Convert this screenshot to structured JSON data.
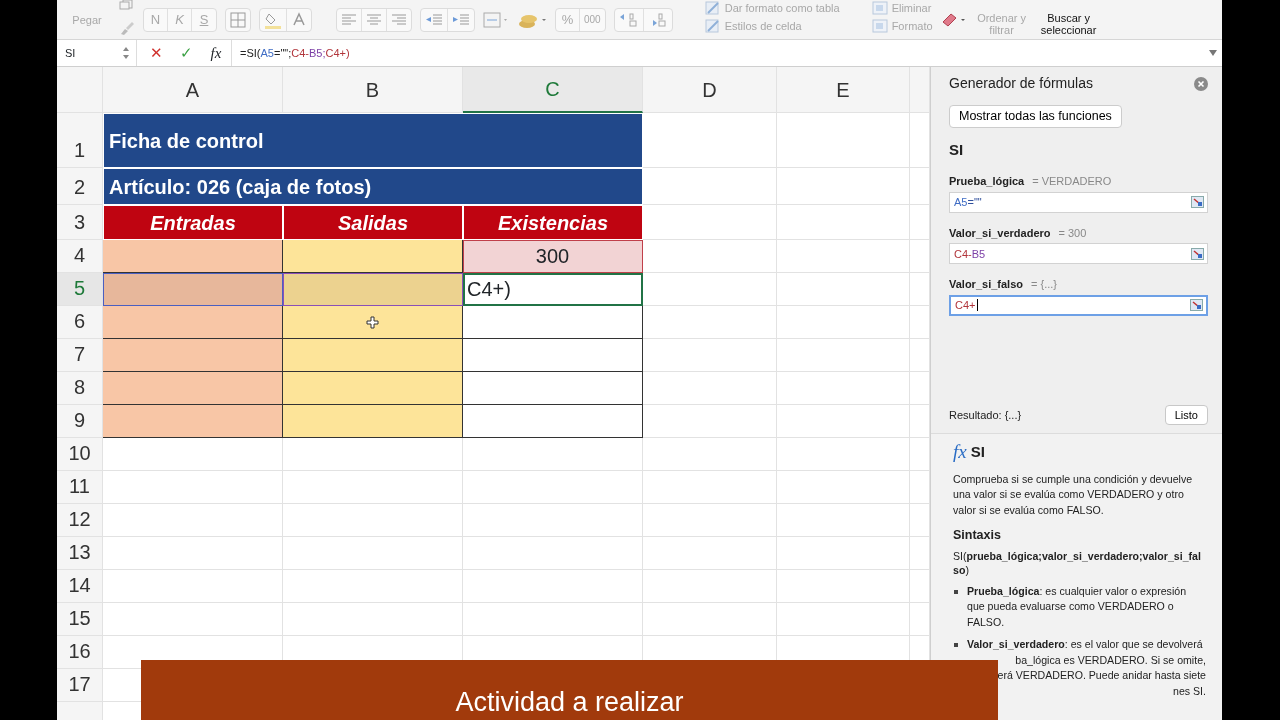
{
  "ribbon": {
    "paste": {
      "label": "Pegar",
      "disabled": true
    },
    "font_buttons": [
      {
        "label": "N",
        "disabled": true
      },
      {
        "label": "K",
        "disabled": true
      },
      {
        "label": "S",
        "disabled": true
      }
    ],
    "number_buttons": [
      {
        "label": "%",
        "disabled": true
      },
      {
        "label": "000",
        "disabled": true
      }
    ],
    "style_commands": [
      {
        "label": "Dar formato como tabla",
        "disabled": true
      },
      {
        "label": "Estilos de celda",
        "disabled": true
      }
    ],
    "cell_commands": [
      {
        "label": "Eliminar",
        "disabled": true
      },
      {
        "label": "Formato",
        "disabled": true
      }
    ],
    "sort_button": {
      "label": "Ordenar y filtrar",
      "disabled": true
    },
    "find_button": {
      "label": "Buscar y seleccionar",
      "disabled": false
    }
  },
  "formula_bar": {
    "name_box": "SI",
    "cancel": "✕",
    "enter": "✓",
    "fx": "fx",
    "tokens": [
      {
        "text": "=SI(",
        "color": "#222222"
      },
      {
        "text": "A5",
        "color": "#3f6cc4"
      },
      {
        "text": "=\"\";",
        "color": "#222222"
      },
      {
        "text": "C4-",
        "color": "#b1343a"
      },
      {
        "text": "B5;",
        "color": "#7c3fa6"
      },
      {
        "text": "C4+)",
        "color": "#b1343a"
      }
    ]
  },
  "sheet": {
    "columns": [
      {
        "label": "A",
        "selected": false
      },
      {
        "label": "B",
        "selected": false
      },
      {
        "label": "C",
        "selected": true
      },
      {
        "label": "D",
        "selected": false
      },
      {
        "label": "E",
        "selected": false
      }
    ],
    "rows": [
      {
        "label": "1",
        "selected": false,
        "cells": [
          {
            "kind": "title",
            "text": "Ficha de control"
          }
        ]
      },
      {
        "label": "2",
        "selected": false,
        "cells": [
          {
            "kind": "title",
            "text": "Artículo: 026 (caja de fotos)"
          }
        ]
      },
      {
        "label": "3",
        "selected": false,
        "cells": [
          {
            "kind": "header",
            "text": "Entradas"
          },
          {
            "kind": "header",
            "text": "Salidas"
          },
          {
            "kind": "header",
            "text": "Existencias"
          }
        ]
      },
      {
        "label": "4",
        "selected": false,
        "cells": [
          {
            "kind": "entrada"
          },
          {
            "kind": "salida"
          },
          {
            "kind": "existencia",
            "text": "300",
            "color": "#c0404a"
          }
        ]
      },
      {
        "label": "5",
        "selected": true,
        "cells": [
          {
            "kind": "entrada",
            "color": "#4a5fc1"
          },
          {
            "kind": "salida",
            "color": "#8a4fb8"
          },
          {
            "kind": "plain",
            "text": "C4+)",
            "editing": true
          }
        ]
      },
      {
        "label": "6",
        "selected": false,
        "cells": [
          {
            "kind": "entrada"
          },
          {
            "kind": "salida"
          },
          {
            "kind": "plain"
          }
        ]
      },
      {
        "label": "7",
        "selected": false,
        "cells": [
          {
            "kind": "entrada"
          },
          {
            "kind": "salida"
          },
          {
            "kind": "plain"
          }
        ]
      },
      {
        "label": "8",
        "selected": false,
        "cells": [
          {
            "kind": "entrada"
          },
          {
            "kind": "salida"
          },
          {
            "kind": "plain"
          }
        ]
      },
      {
        "label": "9",
        "selected": false,
        "cells": [
          {
            "kind": "entrada"
          },
          {
            "kind": "salida"
          },
          {
            "kind": "plain"
          }
        ]
      },
      {
        "label": "10",
        "selected": false
      },
      {
        "label": "11",
        "selected": false
      },
      {
        "label": "12",
        "selected": false
      },
      {
        "label": "13",
        "selected": false
      },
      {
        "label": "14",
        "selected": false
      },
      {
        "label": "15",
        "selected": false
      },
      {
        "label": "16",
        "selected": false
      },
      {
        "label": "17",
        "selected": false
      }
    ]
  },
  "formula_builder": {
    "title": "Generador de fórmulas",
    "back_button": "Mostrar todas las funciones",
    "function": "SI",
    "arguments": [
      {
        "name": "Prueba_lógica",
        "result": "= VERDADERO",
        "focused": false,
        "tokens": [
          {
            "text": "A5",
            "color": "#3f6cc4"
          },
          {
            "text": "=\"\"",
            "color": "#2f4f9c"
          }
        ]
      },
      {
        "name": "Valor_si_verdadero",
        "result": "= 300",
        "focused": false,
        "tokens": [
          {
            "text": "C4-",
            "color": "#b1343a"
          },
          {
            "text": "B5",
            "color": "#7c3fa6"
          }
        ]
      },
      {
        "name": "Valor_si_falso",
        "result": "= {...}",
        "focused": true,
        "tokens": [
          {
            "text": "C4+",
            "color": "#b1343a"
          }
        ]
      }
    ],
    "result_label": "Resultado: {...}",
    "done_button": "Listo",
    "help": {
      "fx": "fx",
      "function": "SI",
      "description": "Comprueba si se cumple una condición y devuelve una valor si se evalúa como VERDADERO y otro valor si se evalúa como FALSO.",
      "syntax_title": "Sintaxis",
      "syntax": "SI(**prueba_lógica;valor_si_verdadero;valor_si_falso**)",
      "bullets": [
        {
          "lines": [
            "**Prueba_lógica**: es cualquier valor o expresión que pueda evaluarse como VERDADERO o FALSO."
          ]
        },
        {
          "lines": [
            "**Valor_si_verdadero**: es el valor que se devolverá",
            "ba_lógica es VERDADERO. Si se omite,",
            "erá VERDADERO. Puede anidar hasta siete",
            "nes SI."
          ]
        }
      ]
    }
  },
  "banner": {
    "text": "Actividad a realizar"
  }
}
